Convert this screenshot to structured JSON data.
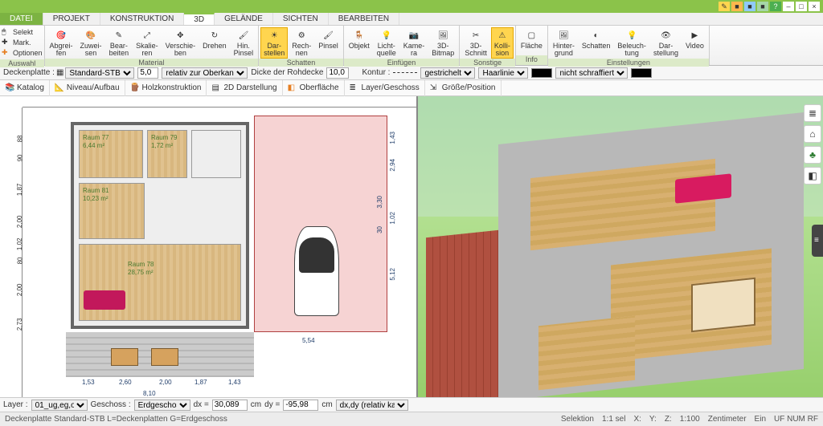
{
  "titlebar": {
    "window_buttons": [
      "■",
      "■",
      "■",
      "■",
      "?",
      "–",
      "□",
      "×"
    ]
  },
  "menu": {
    "tabs": [
      "DATEI",
      "PROJEKT",
      "KONSTRUKTION",
      "3D",
      "GELÄNDE",
      "SICHTEN",
      "BEARBEITEN"
    ],
    "active": "3D"
  },
  "ribbon": {
    "auswahl": {
      "label": "Auswahl",
      "selekt": "Selekt",
      "mark": "Mark.",
      "optionen": "Optionen"
    },
    "material": {
      "label": "Material",
      "buttons": [
        "Abgrei-\nfen",
        "Zuwei-\nsen",
        "Bear-\nbeiten",
        "Skalie-\nren",
        "Verschie-\nben",
        "Drehen",
        "Hin.\nPinsel"
      ]
    },
    "schatten": {
      "label": "Schatten",
      "buttons": [
        "Dar-\nstellen",
        "Rech-\nnen",
        "Pinsel"
      ],
      "selected_index": 0
    },
    "einfuegen": {
      "label": "Einfügen",
      "buttons": [
        "Objekt",
        "Licht-\nquelle",
        "Kame-\nra",
        "3D-\nBitmap"
      ]
    },
    "sonstige": {
      "label": "Sonstige",
      "buttons": [
        "3D-\nSchnitt",
        "Kolli-\nsion"
      ],
      "selected_index": 1
    },
    "info": {
      "label": "Info",
      "buttons": [
        "Fläche"
      ]
    },
    "einstellungen": {
      "label": "Einstellungen",
      "buttons": [
        "Hinter-\ngrund",
        "Schatten",
        "Beleuch-\ntung",
        "Dar-\nstellung",
        "Video"
      ]
    }
  },
  "optbar": {
    "deckenplatte_label": "Deckenplatte :",
    "deckenplatte_value": "Standard-STB",
    "num1": "5,0",
    "span_label": "relativ zur Oberkan",
    "dicke_label": "Dicke der Rohdecke",
    "dicke_value": "10,0",
    "kontur_label": "Kontur :",
    "kontur_value": "gestrichelt",
    "haarlinie": "Haarlinie",
    "schraff_value": "nicht schraffiert",
    "swatch_color": "#000000"
  },
  "toolbar": {
    "items": [
      "Katalog",
      "Niveau/Aufbau",
      "Holzkonstruktion",
      "2D Darstellung",
      "Oberfläche",
      "Layer/Geschoss",
      "Größe/Position"
    ]
  },
  "plan2d": {
    "rooms": [
      {
        "name": "Raum 77",
        "area": "6,44 m²"
      },
      {
        "name": "Raum 79",
        "area": "1,72 m²"
      },
      {
        "name": "Raum 81",
        "area": "10,23 m²"
      },
      {
        "name": "Raum 78",
        "area": "28,75 m²"
      }
    ],
    "dims_h": [
      "1,53",
      "2,60",
      "2,00",
      "1,87",
      "1,43"
    ],
    "dims_v": [
      "88",
      "90",
      "1,87",
      "2,00",
      "1,02",
      "80",
      "2,00",
      "2,73"
    ],
    "dims_carport_v": [
      "1,43",
      "2,94",
      "3,30",
      "1,02",
      "30",
      "5,12"
    ],
    "bottom_total": "8,10",
    "carport_width": "5,54",
    "ruler_v_ticks": [
      "88",
      "90",
      "1,87",
      "2,00",
      "1,02",
      "80",
      "2,00",
      "2,73"
    ]
  },
  "sidetools": {
    "items": [
      {
        "name": "layers-icon",
        "glyph": "≣"
      },
      {
        "name": "house-icon",
        "glyph": "⌂"
      },
      {
        "name": "tree-icon",
        "glyph": "♣"
      },
      {
        "name": "palette-icon",
        "glyph": "◧"
      }
    ]
  },
  "bottombar": {
    "layer_label": "Layer :",
    "layer_value": "01_ug,eg,og",
    "geschoss_label": "Geschoss :",
    "geschoss_value": "Erdgeschos",
    "dx_label": "dx =",
    "dx_value": "30,089",
    "dx_unit": "cm",
    "dy_label": "dy =",
    "dy_value": "-95,98",
    "dy_unit": "cm",
    "mode_value": "dx,dy (relativ ka"
  },
  "statusbar": {
    "left_text": "Deckenplatte Standard-STB L=Deckenplatten G=Erdgeschoss",
    "selektion": "Selektion",
    "sel_value": "1:1 sel",
    "x_label": "X:",
    "y_label": "Y:",
    "z_label": "Z:",
    "scale": "1:100",
    "unit": "Zentimeter",
    "ein": "Ein",
    "flags": "UF NUM RF"
  }
}
